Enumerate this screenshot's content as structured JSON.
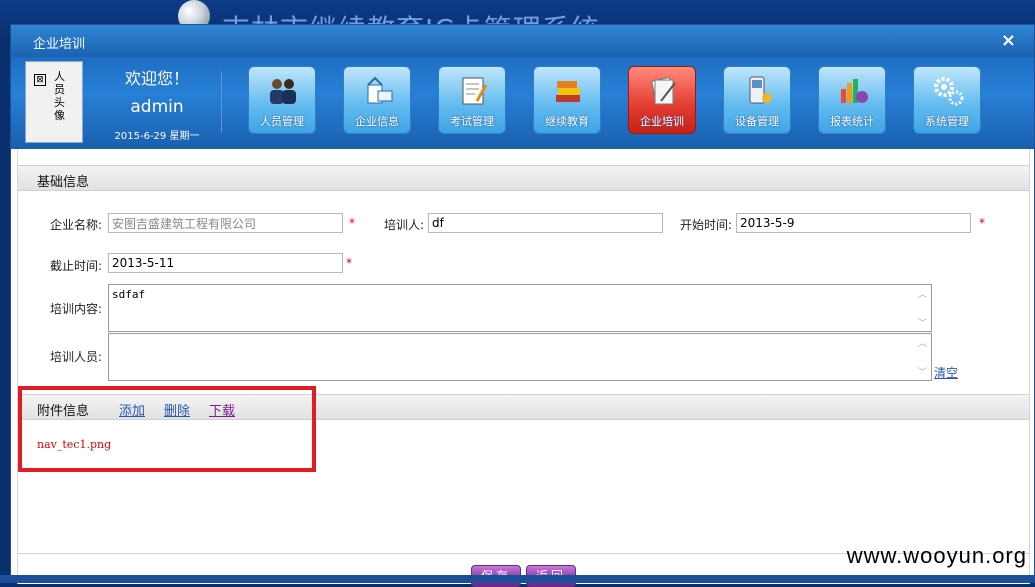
{
  "system": {
    "title": "吉林市继续教育IC卡管理系统"
  },
  "window": {
    "title": "企业培训",
    "close_icon": "×"
  },
  "header": {
    "avatar_label": "人员头像",
    "avatar_icon": "⊠",
    "welcome": "欢迎您！",
    "username": "admin",
    "date": "2015-6-29 星期一"
  },
  "nav": [
    {
      "label": "人员管理",
      "icon": "people-icon",
      "active": false
    },
    {
      "label": "企业信息",
      "icon": "company-icon",
      "active": false
    },
    {
      "label": "考试管理",
      "icon": "exam-icon",
      "active": false
    },
    {
      "label": "继续教育",
      "icon": "books-icon",
      "active": false
    },
    {
      "label": "企业培训",
      "icon": "training-icon",
      "active": true
    },
    {
      "label": "设备管理",
      "icon": "device-icon",
      "active": false
    },
    {
      "label": "报表统计",
      "icon": "chart-icon",
      "active": false
    },
    {
      "label": "系统管理",
      "icon": "gear-icon",
      "active": false
    }
  ],
  "basic": {
    "section_title": "基础信息",
    "company_label": "企业名称:",
    "company_value": "安图吉盛建筑工程有限公司",
    "trainer_label": "培训人:",
    "trainer_value": "df",
    "start_label": "开始时间:",
    "start_value": "2013-5-9",
    "end_label": "截止时间:",
    "end_value": "2013-5-11",
    "content_label": "培训内容:",
    "content_value": "sdfaf",
    "people_label": "培训人员:",
    "people_value": "",
    "clear_label": "清空",
    "required_mark": "*"
  },
  "attachments": {
    "section_title": "附件信息",
    "add_label": "添加",
    "delete_label": "删除",
    "download_label": "下载",
    "files": [
      "nav_tec1.png"
    ]
  },
  "footer": {
    "save_label": "保存",
    "back_label": "返回"
  },
  "watermark": "www.wooyun.org",
  "colors": {
    "accent": "#1a62b1",
    "active_nav": "#e33a2e",
    "required": "#dd0000",
    "file": "#e00000",
    "highlight_box": "#e31b23"
  }
}
